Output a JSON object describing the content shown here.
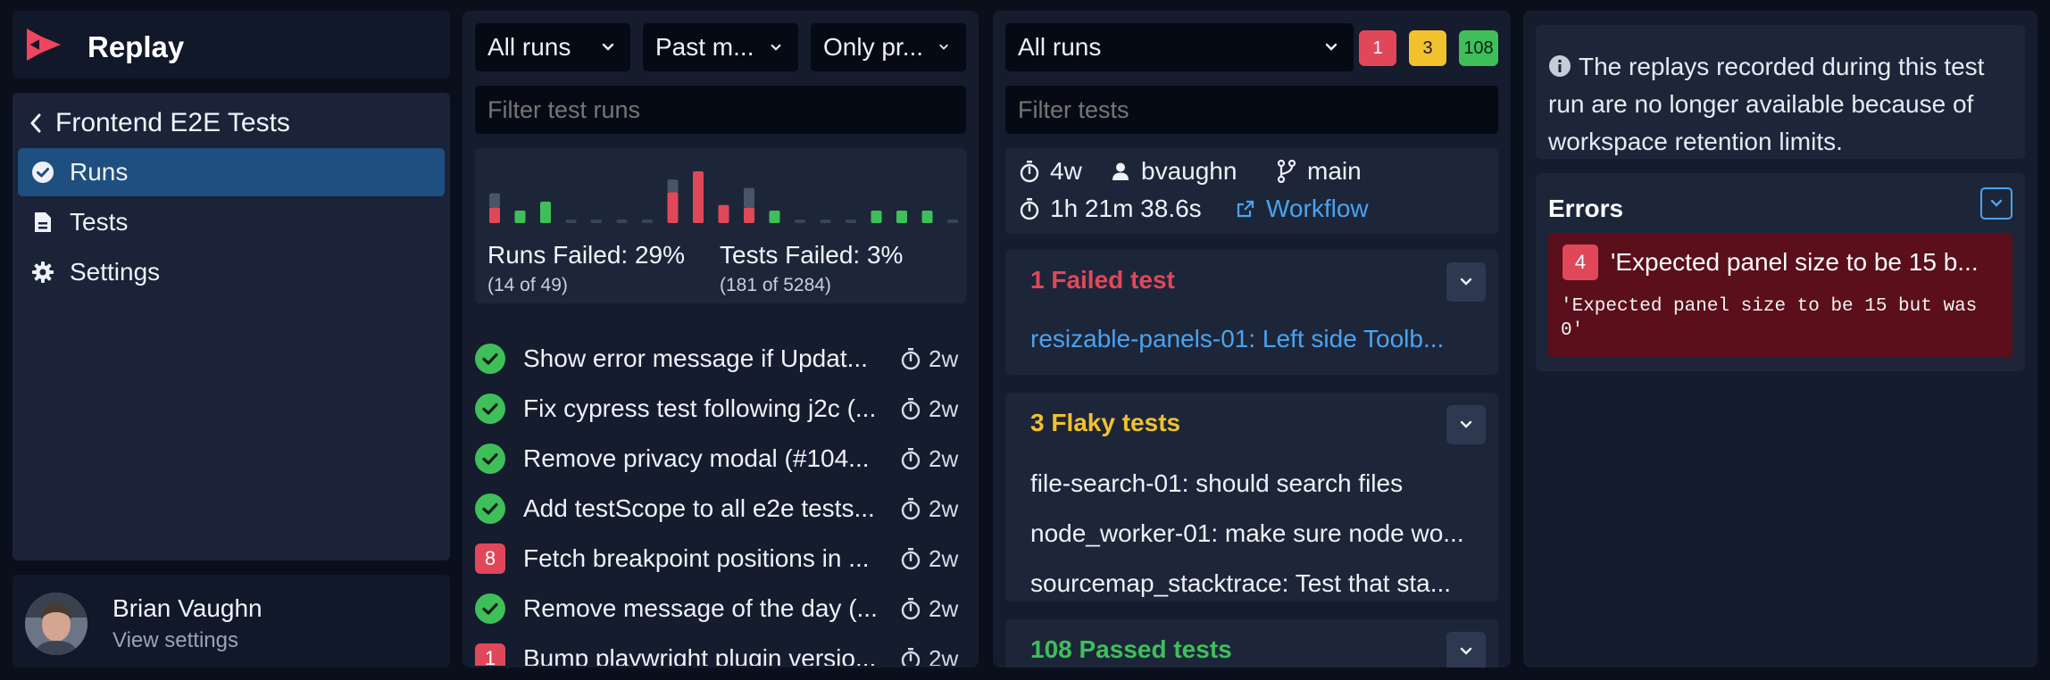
{
  "app": {
    "name": "Replay"
  },
  "sidebar": {
    "back_title": "Frontend E2E Tests",
    "items": [
      {
        "label": "Runs",
        "icon": "check-circle-icon",
        "active": true
      },
      {
        "label": "Tests",
        "icon": "document-icon",
        "active": false
      },
      {
        "label": "Settings",
        "icon": "gear-icon",
        "active": false
      }
    ],
    "user": {
      "name": "Brian Vaughn",
      "subtitle": "View settings"
    }
  },
  "runs_panel": {
    "filters": [
      {
        "label": "All runs"
      },
      {
        "label": "Past m..."
      },
      {
        "label": "Only pr..."
      }
    ],
    "search_placeholder": "Filter test runs",
    "stats": {
      "runs_failed_label": "Runs Failed: 29%",
      "runs_failed_detail": "(14 of 49)",
      "tests_failed_label": "Tests Failed: 3%",
      "tests_failed_detail": "(181 of 5284)"
    },
    "histogram": [
      {
        "fail": 0.3,
        "pass": 0.4,
        "kind": "mixed"
      },
      {
        "fail": 0,
        "pass": 0.35,
        "kind": "pass"
      },
      {
        "fail": 0,
        "pass": 0.6,
        "kind": "pass"
      },
      {
        "fail": 0,
        "pass": 0,
        "kind": "empty"
      },
      {
        "fail": 0,
        "pass": 0,
        "kind": "empty"
      },
      {
        "fail": 0,
        "pass": 0,
        "kind": "empty"
      },
      {
        "fail": 0,
        "pass": 0,
        "kind": "empty"
      },
      {
        "fail": 0.6,
        "pass": 0.35,
        "kind": "mixed"
      },
      {
        "fail": 1.0,
        "pass": 0,
        "kind": "fail"
      },
      {
        "fail": 0.35,
        "pass": 0,
        "kind": "fail"
      },
      {
        "fail": 0.3,
        "pass": 0.55,
        "kind": "mixed"
      },
      {
        "fail": 0,
        "pass": 0.35,
        "kind": "pass"
      },
      {
        "fail": 0,
        "pass": 0,
        "kind": "empty"
      },
      {
        "fail": 0,
        "pass": 0,
        "kind": "empty"
      },
      {
        "fail": 0,
        "pass": 0,
        "kind": "empty"
      },
      {
        "fail": 0,
        "pass": 0.35,
        "kind": "pass"
      },
      {
        "fail": 0,
        "pass": 0.35,
        "kind": "pass"
      },
      {
        "fail": 0,
        "pass": 0.35,
        "kind": "pass"
      },
      {
        "fail": 0,
        "pass": 0,
        "kind": "empty"
      }
    ],
    "runs": [
      {
        "status": "pass",
        "failed": "",
        "title": "Show error message if Updat...",
        "age": "2w"
      },
      {
        "status": "pass",
        "failed": "",
        "title": "Fix cypress test following j2c (...",
        "age": "2w"
      },
      {
        "status": "pass",
        "failed": "",
        "title": "Remove privacy modal (#104...",
        "age": "2w"
      },
      {
        "status": "pass",
        "failed": "",
        "title": "Add testScope to all e2e tests...",
        "age": "2w"
      },
      {
        "status": "fail",
        "failed": "8",
        "title": "Fetch breakpoint positions in ...",
        "age": "2w"
      },
      {
        "status": "pass",
        "failed": "",
        "title": "Remove message of the day (...",
        "age": "2w"
      },
      {
        "status": "fail",
        "failed": "1",
        "title": "Bump playwright plugin versio...",
        "age": "2w"
      }
    ]
  },
  "tests_panel": {
    "filter_label": "All runs",
    "badges": {
      "failed": "1",
      "flaky": "3",
      "passed": "108"
    },
    "search_placeholder": "Filter tests",
    "meta": {
      "age": "4w",
      "user": "bvaughn",
      "branch": "main",
      "duration": "1h 21m 38.6s",
      "workflow": "Workflow"
    },
    "failed_section": {
      "title": "1 Failed test",
      "tests": [
        "resizable-panels-01: Left side Toolb..."
      ]
    },
    "flaky_section": {
      "title": "3 Flaky tests",
      "tests": [
        "file-search-01: should search files",
        "node_worker-01: make sure node wo...",
        "sourcemap_stacktrace: Test that sta..."
      ]
    },
    "passed_section": {
      "title": "108 Passed tests"
    }
  },
  "detail_panel": {
    "notice": "The replays recorded during this test run are no longer available because of workspace retention limits.",
    "errors_title": "Errors",
    "error": {
      "count": "4",
      "message": "'Expected panel size to be 15 b...",
      "detail": "'Expected panel size to be 15 but was 0'"
    }
  },
  "colors": {
    "accent": "#1f4f80",
    "pass": "#3fbf5a",
    "fail": "#e0485a",
    "flaky": "#f2c12e",
    "link": "#4aa3f0"
  }
}
